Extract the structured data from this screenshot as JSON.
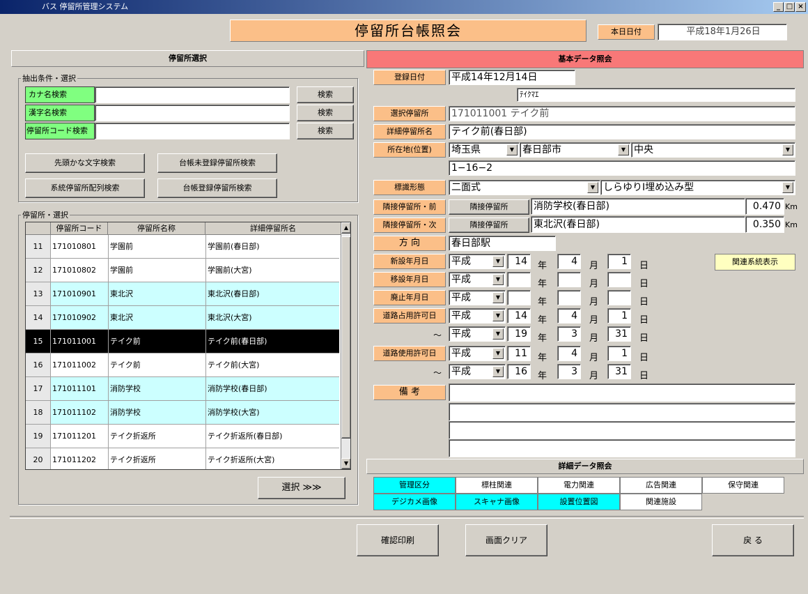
{
  "window": {
    "title": "バス 停留所管理システム",
    "min": "_",
    "max": "□",
    "close": "×"
  },
  "header": {
    "title": "停留所台帳照会",
    "date_label": "本日日付",
    "date_value": "平成18年1月26日"
  },
  "left": {
    "panel_title": "停留所選択",
    "extract_group": "抽出条件・選択",
    "search": [
      {
        "label": "カナ名検索",
        "value": "",
        "button": "検索"
      },
      {
        "label": "漢字名検索",
        "value": "",
        "button": "検索"
      },
      {
        "label": "停留所コード検索",
        "value": "",
        "button": "検索"
      }
    ],
    "buttons": [
      "先頭かな文字検索",
      "台帳未登録停留所検索",
      "系統停留所配列検索",
      "台帳登録停留所検索"
    ],
    "list_group": "停留所・選択",
    "columns": [
      "停留所コード",
      "停留所名称",
      "詳細停留所名"
    ],
    "rows": [
      {
        "no": "11",
        "code": "171010801",
        "name": "学園前",
        "detail": "学園前(春日部)"
      },
      {
        "no": "12",
        "code": "171010802",
        "name": "学園前",
        "detail": "学園前(大宮)"
      },
      {
        "no": "13",
        "code": "171010901",
        "name": "東北沢",
        "detail": "東北沢(春日部)"
      },
      {
        "no": "14",
        "code": "171010902",
        "name": "東北沢",
        "detail": "東北沢(大宮)"
      },
      {
        "no": "15",
        "code": "171011001",
        "name": "テイク前",
        "detail": "テイク前(春日部)"
      },
      {
        "no": "16",
        "code": "171011002",
        "name": "テイク前",
        "detail": "テイク前(大宮)"
      },
      {
        "no": "17",
        "code": "171011101",
        "name": "消防学校",
        "detail": "消防学校(春日部)"
      },
      {
        "no": "18",
        "code": "171011102",
        "name": "消防学校",
        "detail": "消防学校(大宮)"
      },
      {
        "no": "19",
        "code": "171011201",
        "name": "テイク折返所",
        "detail": "テイク折返所(春日部)"
      },
      {
        "no": "20",
        "code": "171011202",
        "name": "テイク折返所",
        "detail": "テイク折返所(大宮)"
      }
    ],
    "select_button": "選択 ≫≫"
  },
  "right": {
    "panel_title": "基本データ照会",
    "reg_date_label": "登録日付",
    "reg_date": "平成14年12月14日",
    "kana": "ﾃｲｸﾏｴ",
    "selected_label": "選択停留所",
    "selected": "171011001 テイク前",
    "detail_label": "詳細停留所名",
    "detail": "テイク前(春日部)",
    "location_label": "所在地(位置)",
    "pref": "埼玉県",
    "city": "春日部市",
    "area": "中央",
    "address": "1−16−2",
    "sign_label": "標識形態",
    "sign1": "二面式",
    "sign2": "しらゆりⅠ埋め込み型",
    "prev_label": "隣接停留所・前",
    "next_label": "隣接停留所・次",
    "adj_btn": "隣接停留所",
    "prev_name": "消防学校(春日部)",
    "prev_dist": "0.470",
    "next_name": "東北沢(春日部)",
    "next_dist": "0.350",
    "km": "Km",
    "dir_label": "方 向",
    "dir": "春日部駅",
    "related_btn": "関連系統表示",
    "era": "平成",
    "nen": "年",
    "tsuki": "月",
    "hi": "日",
    "tilde": "～",
    "dates": [
      {
        "label": "新設年月日",
        "y": "14",
        "m": "4",
        "d": "1"
      },
      {
        "label": "移設年月日",
        "y": "",
        "m": "",
        "d": ""
      },
      {
        "label": "廃止年月日",
        "y": "",
        "m": "",
        "d": ""
      },
      {
        "label": "道路占用許可日",
        "y": "14",
        "m": "4",
        "d": "1"
      },
      {
        "label": "",
        "y": "19",
        "m": "3",
        "d": "31"
      },
      {
        "label": "道路使用許可日",
        "y": "11",
        "m": "4",
        "d": "1"
      },
      {
        "label": "",
        "y": "16",
        "m": "3",
        "d": "31"
      }
    ],
    "memo_label": "備 考",
    "detail_title": "詳細データ照会",
    "tabs_row1": [
      "管理区分",
      "標柱関連",
      "電力関連",
      "広告関連",
      "保守関連"
    ],
    "tabs_row2": [
      "デジカメ画像",
      "スキャナ画像",
      "設置位置図",
      "関連施設"
    ]
  },
  "footer": {
    "print": "確認印刷",
    "clear": "画面クリア",
    "back": "戻 る"
  }
}
